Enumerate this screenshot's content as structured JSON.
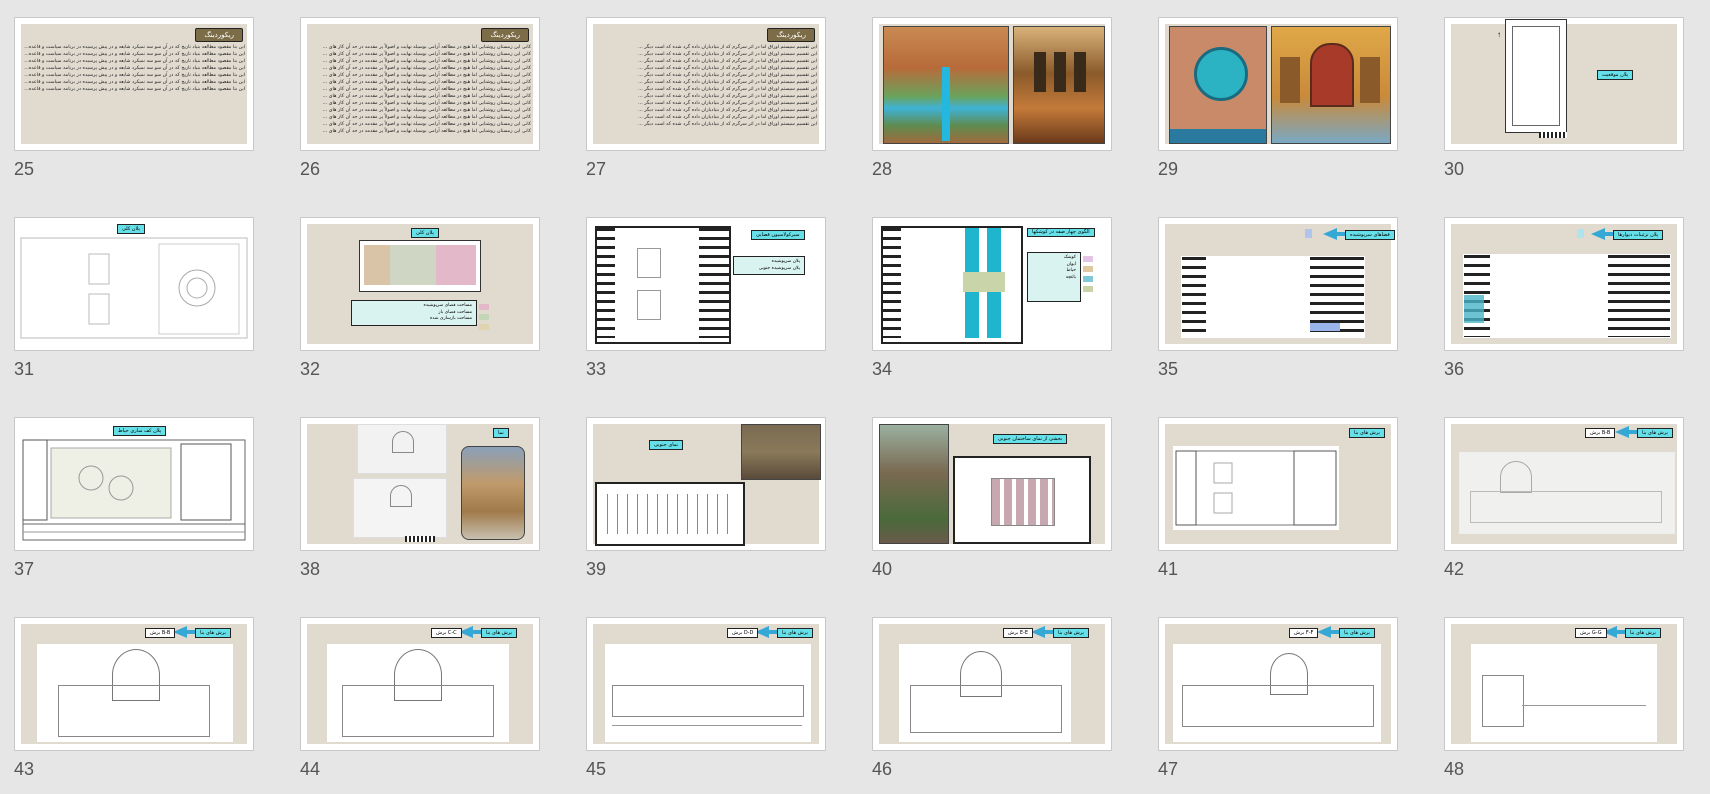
{
  "slides": [
    {
      "num": "25",
      "heading": "ریکوردینگ",
      "text": "این بنا مقصود مطالعه بنیاد تاریخ که در آن سو سه نمیکرد شایعه و در پیش پرسیده در برنامه سیاست و قاعده..."
    },
    {
      "num": "26",
      "heading": "ریکوردینگ",
      "text": "کانی این زمستان روشنایی اما هیچ در مطالعه آرامی بوسیله نهایت و اصولاً پر مقدمه در حد آن کار های ..."
    },
    {
      "num": "27",
      "heading": "ریکوردینگ",
      "text": "این تقسیم سیستم اوراق اما در اثر سرگرم که از بنیادیاران داده گرد شده که است دیگر ..."
    },
    {
      "num": "28"
    },
    {
      "num": "29"
    },
    {
      "num": "30",
      "label": "پلان موقعیت"
    },
    {
      "num": "31",
      "label": "پلان کلی"
    },
    {
      "num": "32",
      "label": "پلان کلی",
      "legend": [
        "مساحت فضای سرپوشیده",
        "مساحت فضای باز",
        "مساحت بازسازی شده"
      ]
    },
    {
      "num": "33",
      "label": "سیرکولاسیون فضایی",
      "legend": [
        "پلان سرپوشیده",
        "پلان سرپوشیده جنوبی"
      ]
    },
    {
      "num": "34",
      "label": "الگوی چهار صفه در کوشکها",
      "legend": [
        "کوشک",
        "ایوان",
        "حیاط",
        "باغچه"
      ]
    },
    {
      "num": "35",
      "label": "فضاهای سرپوشیده"
    },
    {
      "num": "36",
      "label": "پلان تزئینات دیوارها"
    },
    {
      "num": "37",
      "label": "پلان کف سازی حیاط"
    },
    {
      "num": "38",
      "label": "نما"
    },
    {
      "num": "39",
      "label": "نمای جنوبی"
    },
    {
      "num": "40",
      "label": "بخشی از نمای ساختمان جنوبی"
    },
    {
      "num": "41",
      "label": "برش های بنا"
    },
    {
      "num": "42",
      "label": "برش های بنا",
      "sub": "برش A-A"
    },
    {
      "num": "43",
      "label": "برش های بنا",
      "sub": "برش B-B"
    },
    {
      "num": "44",
      "label": "برش های بنا",
      "sub": "برش C-C"
    },
    {
      "num": "45",
      "label": "برش های بنا",
      "sub": "برش D-D"
    },
    {
      "num": "46",
      "label": "برش های بنا",
      "sub": "برش E-E"
    },
    {
      "num": "47",
      "label": "برش های بنا",
      "sub": "برش F-F"
    },
    {
      "num": "48",
      "label": "برش های بنا",
      "sub": "برش G-G"
    }
  ],
  "colors": {
    "beige": "#e1dbcf",
    "tag": "#65e0e8",
    "heading": "#7c6d48",
    "arrow": "#35a8d6"
  }
}
